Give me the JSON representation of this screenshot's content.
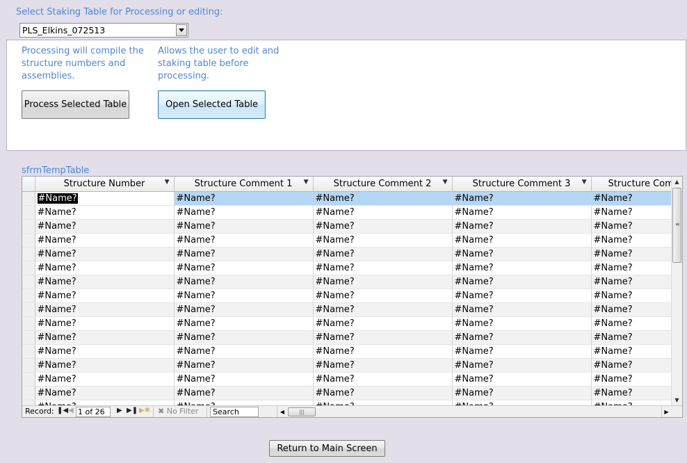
{
  "header": {
    "select_label": "Select Staking Table for Processing or editing:",
    "combo_value": "PLS_Elkins_072513"
  },
  "panel": {
    "process_desc": "Processing will compile the structure numbers and assemblies.",
    "open_desc": "Allows the user to edit and staking table before processing.",
    "process_button": "Process Selected Table",
    "open_button": "Open Selected Table"
  },
  "subform": {
    "label": "sfrmTempTable",
    "columns": [
      "Structure Number",
      "Structure Comment 1",
      "Structure Comment 2",
      "Structure Comment 3",
      "Structure Com"
    ],
    "cell_value": "#Name?",
    "row_count_visible": 16
  },
  "navigation": {
    "record_label": "Record:",
    "record_position": "1 of 26",
    "filter_label": "No Filter",
    "search_label": "Search"
  },
  "footer": {
    "return_button": "Return to Main Screen"
  },
  "colors": {
    "background": "#e2dfea",
    "label_blue": "#4f86d4",
    "row_selected": "#b5d7f5"
  }
}
